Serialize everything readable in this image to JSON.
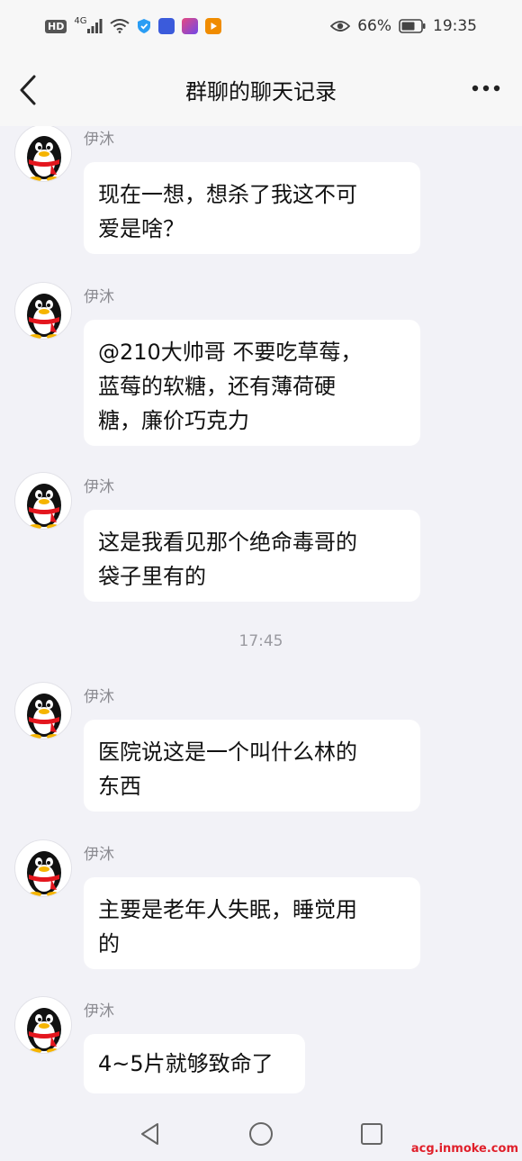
{
  "status_bar": {
    "hd": "HD",
    "network": "4G",
    "battery_percent": "66%",
    "time": "19:35",
    "icons": [
      "signal-icon",
      "wifi-icon",
      "shield-icon",
      "app-icon",
      "app-icon",
      "video-icon",
      "eye-icon",
      "battery-icon"
    ]
  },
  "header": {
    "title": "群聊的聊天记录"
  },
  "messages": [
    {
      "sender": "伊沐",
      "text": "现在一想，想杀了我这不可\n爱是啥？"
    },
    {
      "sender": "伊沐",
      "text": "@210大帅哥 不要吃草莓，\n蓝莓的软糖，还有薄荷硬\n糖，廉价巧克力"
    },
    {
      "sender": "伊沐",
      "text": "这是我看见那个绝命毒哥的\n袋子里有的"
    },
    {
      "time": "17:45"
    },
    {
      "sender": "伊沐",
      "text": "医院说这是一个叫什么林的\n东西"
    },
    {
      "sender": "伊沐",
      "text": "主要是老年人失眠，睡觉用\n的"
    },
    {
      "sender": "伊沐",
      "text": "4~5片就够致命了"
    }
  ],
  "watermark": "acg.inmoke.com",
  "colors": {
    "background": "#f2f2f7",
    "bubble": "#ffffff",
    "watermark": "#e0202b"
  }
}
